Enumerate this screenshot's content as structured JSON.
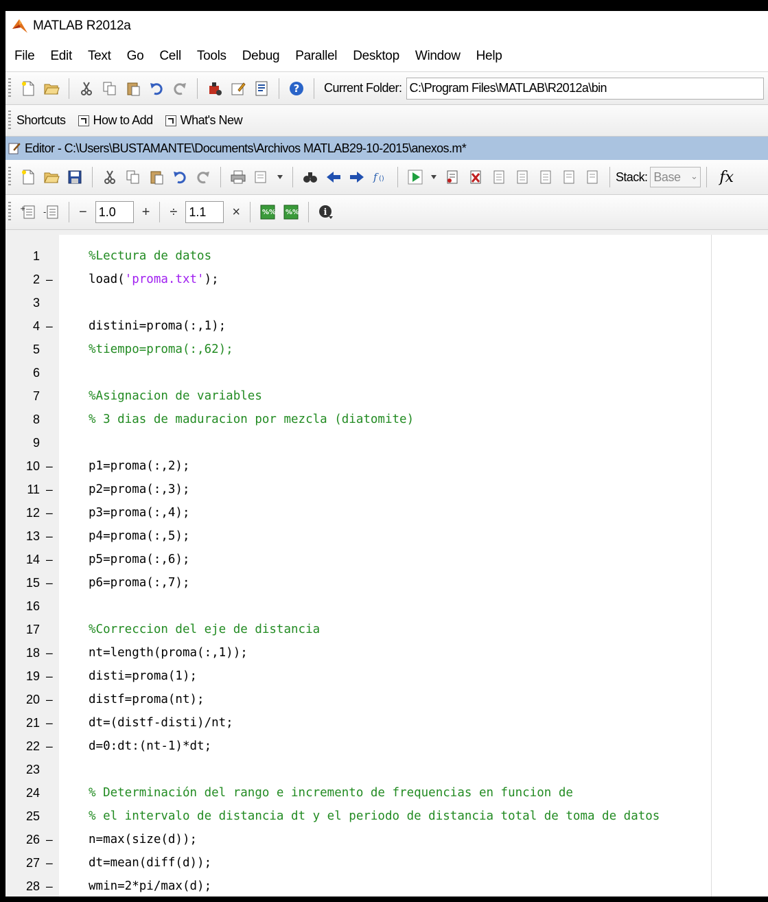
{
  "app": {
    "title": "MATLAB  R2012a"
  },
  "menu": [
    "File",
    "Edit",
    "Text",
    "Go",
    "Cell",
    "Tools",
    "Debug",
    "Parallel",
    "Desktop",
    "Window",
    "Help"
  ],
  "toolbar": {
    "current_folder_label": "Current Folder:",
    "current_folder_value": "C:\\Program Files\\MATLAB\\R2012a\\bin"
  },
  "shortcuts": {
    "label": "Shortcuts",
    "items": [
      "How to Add",
      "What's New"
    ]
  },
  "editor": {
    "title": "Editor - C:\\Users\\BUSTAMANTE\\Documents\\Archivos MATLAB29-10-2015\\anexos.m*",
    "stack_label": "Stack:",
    "stack_value": "Base",
    "fx_label": "fx",
    "cell_minus": "−",
    "cell_value_1": "1.0",
    "cell_plus": "+",
    "cell_divide": "÷",
    "cell_value_2": "1.1",
    "cell_times": "×"
  },
  "code_lines": [
    {
      "num": "1",
      "dash": "",
      "text": "%Lectura de datos",
      "kind": "comment"
    },
    {
      "num": "2",
      "dash": "–",
      "text": "load('proma.txt');",
      "kind": "load"
    },
    {
      "num": "3",
      "dash": "",
      "text": "",
      "kind": "code"
    },
    {
      "num": "4",
      "dash": "–",
      "text": "distini=proma(:,1);",
      "kind": "code"
    },
    {
      "num": "5",
      "dash": "",
      "text": "%tiempo=proma(:,62);",
      "kind": "comment"
    },
    {
      "num": "6",
      "dash": "",
      "text": "",
      "kind": "code"
    },
    {
      "num": "7",
      "dash": "",
      "text": "%Asignacion de variables",
      "kind": "comment"
    },
    {
      "num": "8",
      "dash": "",
      "text": "% 3 dias de maduracion por mezcla (diatomite)",
      "kind": "comment"
    },
    {
      "num": "9",
      "dash": "",
      "text": "",
      "kind": "code"
    },
    {
      "num": "10",
      "dash": "–",
      "text": "p1=proma(:,2);",
      "kind": "code"
    },
    {
      "num": "11",
      "dash": "–",
      "text": "p2=proma(:,3);",
      "kind": "code"
    },
    {
      "num": "12",
      "dash": "–",
      "text": "p3=proma(:,4);",
      "kind": "code"
    },
    {
      "num": "13",
      "dash": "–",
      "text": "p4=proma(:,5);",
      "kind": "code"
    },
    {
      "num": "14",
      "dash": "–",
      "text": "p5=proma(:,6);",
      "kind": "code"
    },
    {
      "num": "15",
      "dash": "–",
      "text": "p6=proma(:,7);",
      "kind": "code"
    },
    {
      "num": "16",
      "dash": "",
      "text": "",
      "kind": "code"
    },
    {
      "num": "17",
      "dash": "",
      "text": "%Correccion del eje de distancia",
      "kind": "comment"
    },
    {
      "num": "18",
      "dash": "–",
      "text": "nt=length(proma(:,1));",
      "kind": "code"
    },
    {
      "num": "19",
      "dash": "–",
      "text": "disti=proma(1);",
      "kind": "code"
    },
    {
      "num": "20",
      "dash": "–",
      "text": "distf=proma(nt);",
      "kind": "code"
    },
    {
      "num": "21",
      "dash": "–",
      "text": "dt=(distf-disti)/nt;",
      "kind": "code"
    },
    {
      "num": "22",
      "dash": "–",
      "text": "d=0:dt:(nt-1)*dt;",
      "kind": "code"
    },
    {
      "num": "23",
      "dash": "",
      "text": "",
      "kind": "code"
    },
    {
      "num": "24",
      "dash": "",
      "text": "% Determinación del rango e incremento de frequencias en funcion de",
      "kind": "comment"
    },
    {
      "num": "25",
      "dash": "",
      "text": "% el intervalo de distancia dt y el periodo de distancia total de toma de datos",
      "kind": "comment"
    },
    {
      "num": "26",
      "dash": "–",
      "text": "n=max(size(d));",
      "kind": "code"
    },
    {
      "num": "27",
      "dash": "–",
      "text": "dt=mean(diff(d));",
      "kind": "code"
    },
    {
      "num": "28",
      "dash": "–",
      "text": "wmin=2*pi/max(d);",
      "kind": "code"
    }
  ],
  "load_parts": {
    "pre": "load(",
    "str": "'proma.txt'",
    "post": ");"
  }
}
